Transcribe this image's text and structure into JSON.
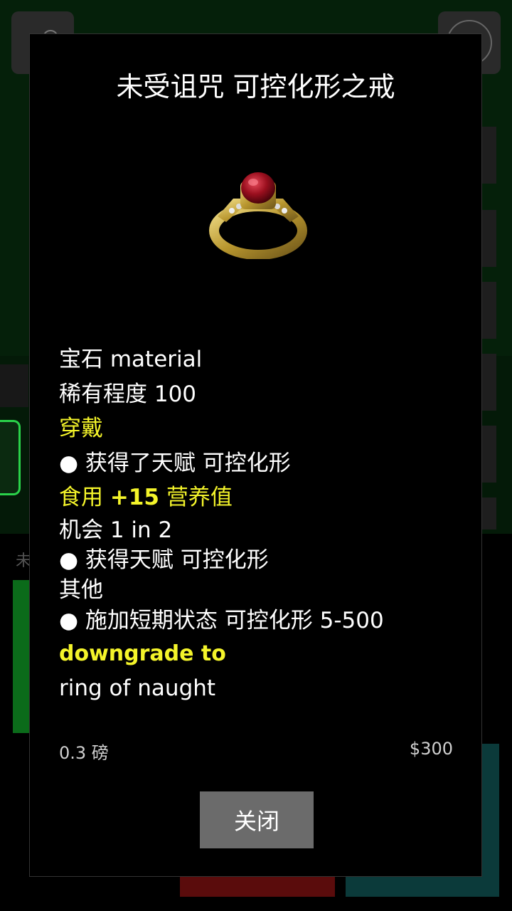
{
  "background": {
    "partial_char": "未"
  },
  "dialog": {
    "title": "未受诅咒 可控化形之戒",
    "item_image": "gold-ruby-ring-icon",
    "lines": {
      "material": "宝石 material",
      "rarity": "稀有程度 100",
      "wear_heading": "穿戴",
      "wear_effect": "● 获得了天赋 可控化形",
      "eat_heading_prefix": "食用 ",
      "eat_heading_value": "+15",
      "eat_heading_suffix": " 营养值",
      "chance": "机会 1 in 2",
      "eat_effect": "● 获得天赋 可控化形",
      "other_heading": "其他",
      "other_effect": "● 施加短期状态 可控化形 5-500",
      "downgrade_heading": "downgrade to",
      "downgrade_target": "ring of naught"
    },
    "weight": "0.3 磅",
    "price": "$300",
    "close_label": "关闭"
  },
  "colors": {
    "highlight": "#f4f42a",
    "close_button": "#6b6b6b"
  }
}
